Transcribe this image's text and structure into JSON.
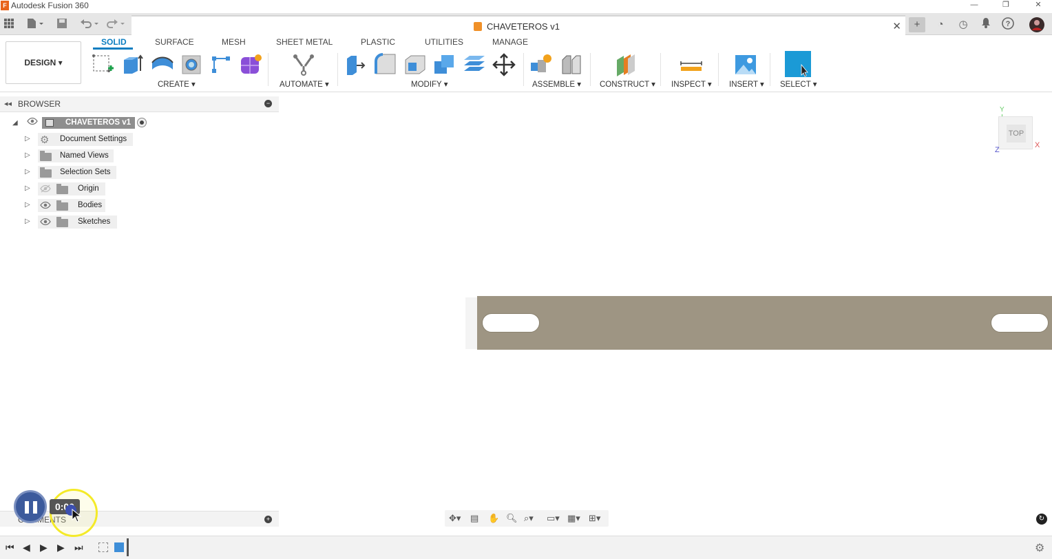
{
  "window": {
    "title": "Autodesk Fusion 360",
    "app_icon_letter": "F"
  },
  "document_tab": {
    "title": "CHAVETEROS v1"
  },
  "ribbon": {
    "workspace": "DESIGN ▾",
    "tabs": [
      "SOLID",
      "SURFACE",
      "MESH",
      "SHEET METAL",
      "PLASTIC",
      "UTILITIES",
      "MANAGE"
    ],
    "active_tab": "SOLID",
    "groups": {
      "create": "CREATE ▾",
      "automate": "AUTOMATE ▾",
      "modify": "MODIFY ▾",
      "assemble": "ASSEMBLE ▾",
      "construct": "CONSTRUCT ▾",
      "inspect": "INSPECT ▾",
      "insert": "INSERT ▾",
      "select": "SELECT ▾"
    }
  },
  "browser": {
    "title": "BROWSER",
    "root": "CHAVETEROS v1",
    "items": [
      "Document Settings",
      "Named Views",
      "Selection Sets",
      "Origin",
      "Bodies",
      "Sketches"
    ]
  },
  "viewcube": {
    "face": "TOP",
    "axis_y": "Y",
    "axis_x": "X",
    "axis_z": "Z"
  },
  "comments": {
    "title": "COMMENTS"
  },
  "recorder": {
    "time": "0:00"
  },
  "colors": {
    "accent": "#0a7dc0",
    "body": "#9e9583",
    "select_tool": "#1b9ad6"
  }
}
